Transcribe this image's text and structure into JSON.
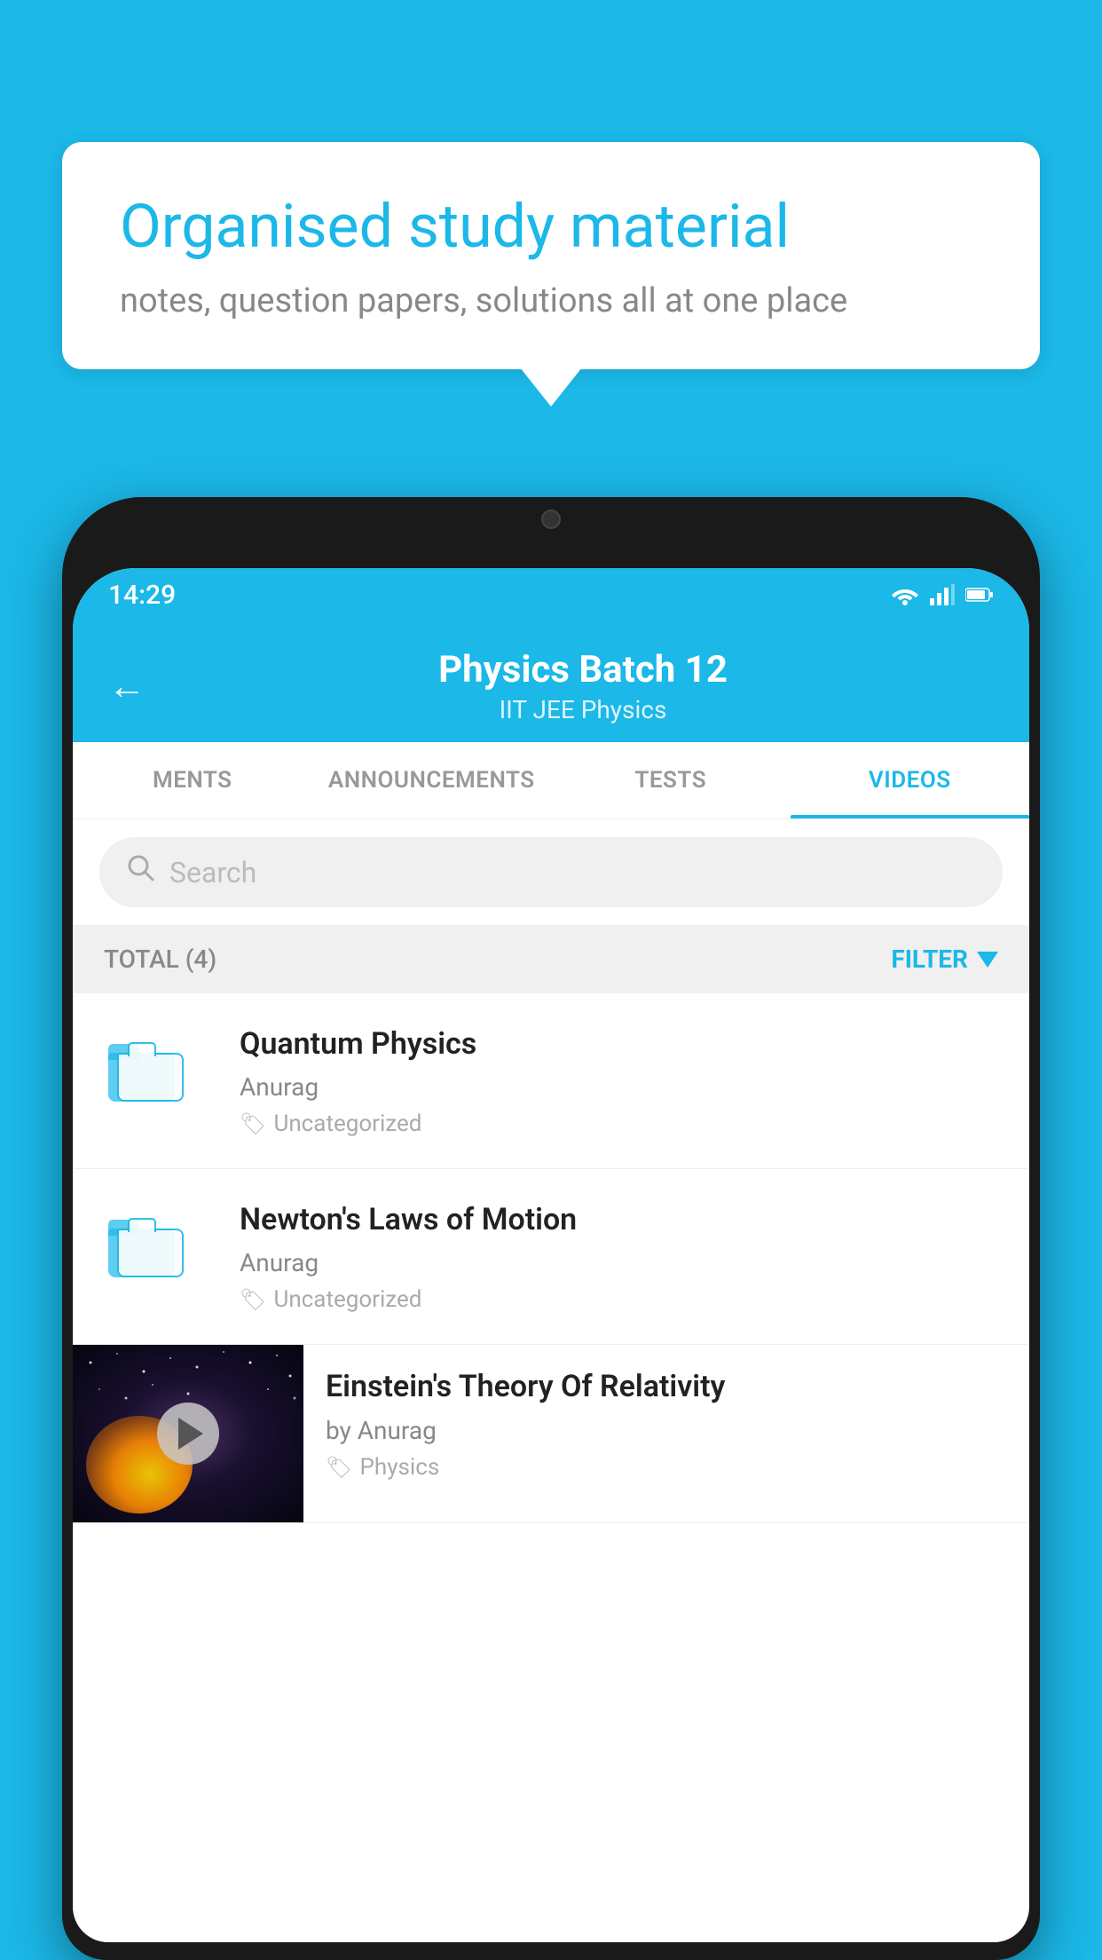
{
  "background_color": "#1BB8E8",
  "speech_bubble": {
    "title": "Organised study material",
    "subtitle": "notes, question papers, solutions all at one place"
  },
  "phone": {
    "status_bar": {
      "time": "14:29",
      "icons": [
        "wifi",
        "signal",
        "battery"
      ]
    },
    "header": {
      "back_label": "←",
      "title": "Physics Batch 12",
      "subtitle": "IIT JEE    Physics"
    },
    "tabs": [
      {
        "label": "MENTS",
        "active": false
      },
      {
        "label": "ANNOUNCEMENTS",
        "active": false
      },
      {
        "label": "TESTS",
        "active": false
      },
      {
        "label": "VIDEOS",
        "active": true
      }
    ],
    "search": {
      "placeholder": "Search"
    },
    "filter_bar": {
      "total_label": "TOTAL (4)",
      "filter_label": "FILTER"
    },
    "videos": [
      {
        "title": "Quantum Physics",
        "author": "Anurag",
        "tag": "Uncategorized",
        "has_thumbnail": false
      },
      {
        "title": "Newton's Laws of Motion",
        "author": "Anurag",
        "tag": "Uncategorized",
        "has_thumbnail": false
      },
      {
        "title": "Einstein's Theory Of Relativity",
        "author": "by Anurag",
        "tag": "Physics",
        "has_thumbnail": true
      }
    ]
  }
}
